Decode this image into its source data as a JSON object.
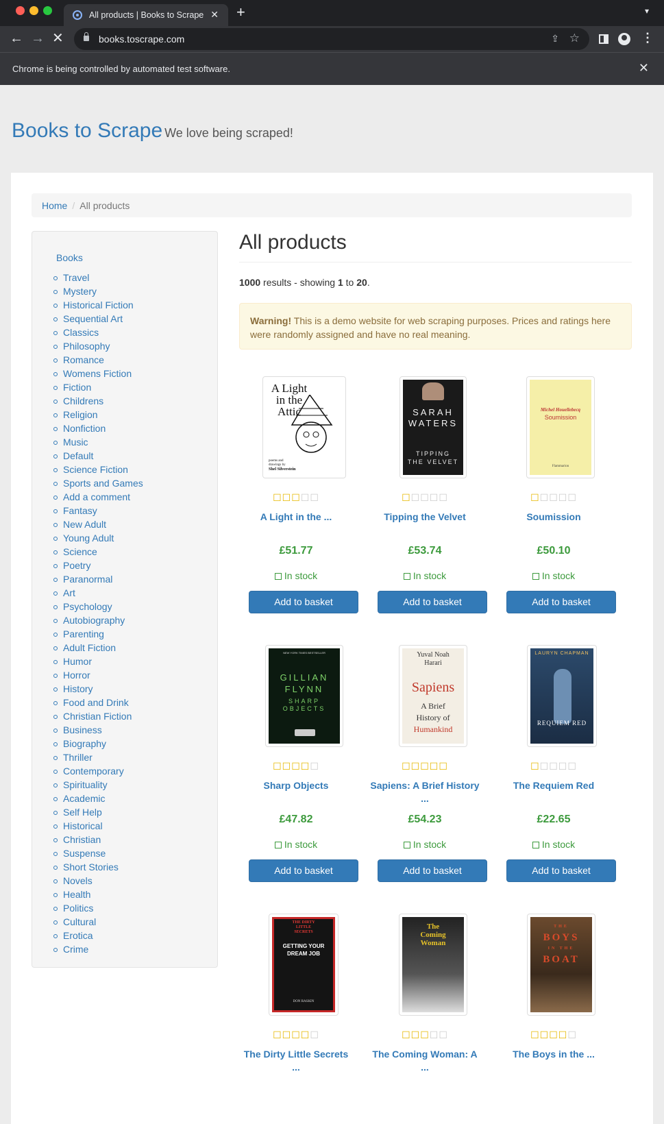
{
  "browser": {
    "tab_title": "All products | Books to Scrape",
    "url": "books.toscrape.com",
    "infobar_message": "Chrome is being controlled by automated test software."
  },
  "site": {
    "name": "Books to Scrape",
    "tagline": "We love being scraped!"
  },
  "breadcrumb": {
    "home": "Home",
    "active": "All products"
  },
  "sidebar": {
    "root": "Books",
    "categories": [
      "Travel",
      "Mystery",
      "Historical Fiction",
      "Sequential Art",
      "Classics",
      "Philosophy",
      "Romance",
      "Womens Fiction",
      "Fiction",
      "Childrens",
      "Religion",
      "Nonfiction",
      "Music",
      "Default",
      "Science Fiction",
      "Sports and Games",
      "Add a comment",
      "Fantasy",
      "New Adult",
      "Young Adult",
      "Science",
      "Poetry",
      "Paranormal",
      "Art",
      "Psychology",
      "Autobiography",
      "Parenting",
      "Adult Fiction",
      "Humor",
      "Horror",
      "History",
      "Food and Drink",
      "Christian Fiction",
      "Business",
      "Biography",
      "Thriller",
      "Contemporary",
      "Spirituality",
      "Academic",
      "Self Help",
      "Historical",
      "Christian",
      "Suspense",
      "Short Stories",
      "Novels",
      "Health",
      "Politics",
      "Cultural",
      "Erotica",
      "Crime"
    ]
  },
  "content": {
    "heading": "All products",
    "results_total": "1000",
    "results_mid": " results - showing ",
    "results_from": "1",
    "results_to_word": " to ",
    "results_to": "20",
    "results_end": ".",
    "warning_label": "Warning!",
    "warning_text": " This is a demo website for web scraping purposes. Prices and ratings here were randomly assigned and have no real meaning."
  },
  "products": [
    {
      "title": "A Light in the ...",
      "price": "£51.77",
      "rating": 3,
      "stock": "In stock",
      "button": "Add to basket"
    },
    {
      "title": "Tipping the Velvet",
      "price": "£53.74",
      "rating": 1,
      "stock": "In stock",
      "button": "Add to basket"
    },
    {
      "title": "Soumission",
      "price": "£50.10",
      "rating": 1,
      "stock": "In stock",
      "button": "Add to basket"
    },
    {
      "title": "Sharp Objects",
      "price": "£47.82",
      "rating": 4,
      "stock": "In stock",
      "button": "Add to basket"
    },
    {
      "title": "Sapiens: A Brief History ...",
      "price": "£54.23",
      "rating": 5,
      "stock": "In stock",
      "button": "Add to basket"
    },
    {
      "title": "The Requiem Red",
      "price": "£22.65",
      "rating": 1,
      "stock": "In stock",
      "button": "Add to basket"
    },
    {
      "title": "The Dirty Little Secrets ...",
      "price": "",
      "rating": 4,
      "stock": "",
      "button": ""
    },
    {
      "title": "The Coming Woman: A ...",
      "price": "",
      "rating": 3,
      "stock": "",
      "button": ""
    },
    {
      "title": "The Boys in the ...",
      "price": "",
      "rating": 4,
      "stock": "",
      "button": ""
    }
  ],
  "covers": {
    "c1": {
      "line1": "A Light",
      "line2": "in the",
      "line3": "Attic",
      "foot1": "poems and",
      "foot2": "drawings by",
      "author": "Shel Silverstein"
    },
    "c2": {
      "author1": "SARAH",
      "author2": "WATERS",
      "title1": "TIPPING",
      "title2": "THE VELVET"
    },
    "c3": {
      "author": "Michel Houellebecq",
      "title": "Soumission",
      "publisher": "Flammarion"
    },
    "c4": {
      "top": "NEW YORK TIMES BESTSELLER",
      "a1": "GILLIAN",
      "a2": "FLYNN",
      "t1": "SHARP",
      "t2": "OBJECTS"
    },
    "c5": {
      "author1": "Yuval Noah",
      "author2": "Harari",
      "title": "Sapiens",
      "sub1": "A Brief",
      "sub2": "History of",
      "sub3": "Humankind"
    },
    "c6": {
      "author": "LAURYN CHAPMAN",
      "title": "REQUIEM RED"
    },
    "c7": {
      "top1": "THE DIRTY",
      "top2": "LITTLE",
      "top3": "SECRETS",
      "t1": "GETTING YOUR",
      "t2": "DREAM JOB",
      "author": "DON RASKIN"
    },
    "c8": {
      "t1": "The",
      "t2": "Coming",
      "t3": "Woman"
    },
    "c9": {
      "t1": "THE",
      "t2": "BOYS",
      "t3": "IN THE",
      "t4": "BOAT"
    }
  },
  "colors": {
    "link": "#337ab7",
    "price": "#3c9a3c",
    "star": "#e6b800",
    "button": "#337ab7"
  }
}
